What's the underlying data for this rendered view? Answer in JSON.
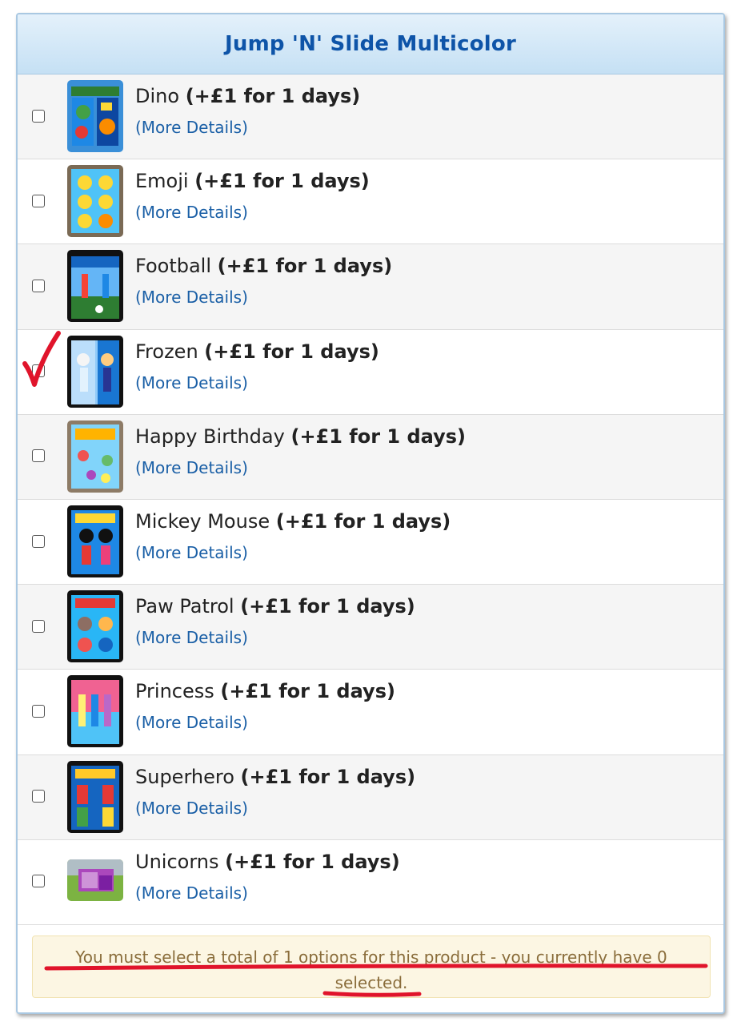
{
  "panel": {
    "title": "Jump 'N' Slide Multicolor"
  },
  "options": [
    {
      "name": "Dino",
      "price": "(+£1 for 1 days)",
      "more": "(More Details)"
    },
    {
      "name": "Emoji",
      "price": "(+£1 for 1 days)",
      "more": "(More Details)"
    },
    {
      "name": "Football",
      "price": "(+£1 for 1 days)",
      "more": "(More Details)"
    },
    {
      "name": "Frozen",
      "price": "(+£1 for 1 days)",
      "more": "(More Details)"
    },
    {
      "name": "Happy Birthday",
      "price": "(+£1 for 1 days)",
      "more": "(More Details)"
    },
    {
      "name": "Mickey Mouse",
      "price": "(+£1 for 1 days)",
      "more": "(More Details)"
    },
    {
      "name": "Paw Patrol",
      "price": "(+£1 for 1 days)",
      "more": "(More Details)"
    },
    {
      "name": "Princess",
      "price": "(+£1 for 1 days)",
      "more": "(More Details)"
    },
    {
      "name": "Superhero",
      "price": "(+£1 for 1 days)",
      "more": "(More Details)"
    },
    {
      "name": "Unicorns",
      "price": "(+£1 for 1 days)",
      "more": "(More Details)"
    }
  ],
  "alert": {
    "message": "You must select a total of 1 options for this product - you currently have 0 selected."
  },
  "colors": {
    "title": "#0e54a8",
    "link": "#1a5fa6",
    "annotation": "#e0142b",
    "alert_bg": "#fcf6e3",
    "alert_text": "#8a6d3b"
  }
}
